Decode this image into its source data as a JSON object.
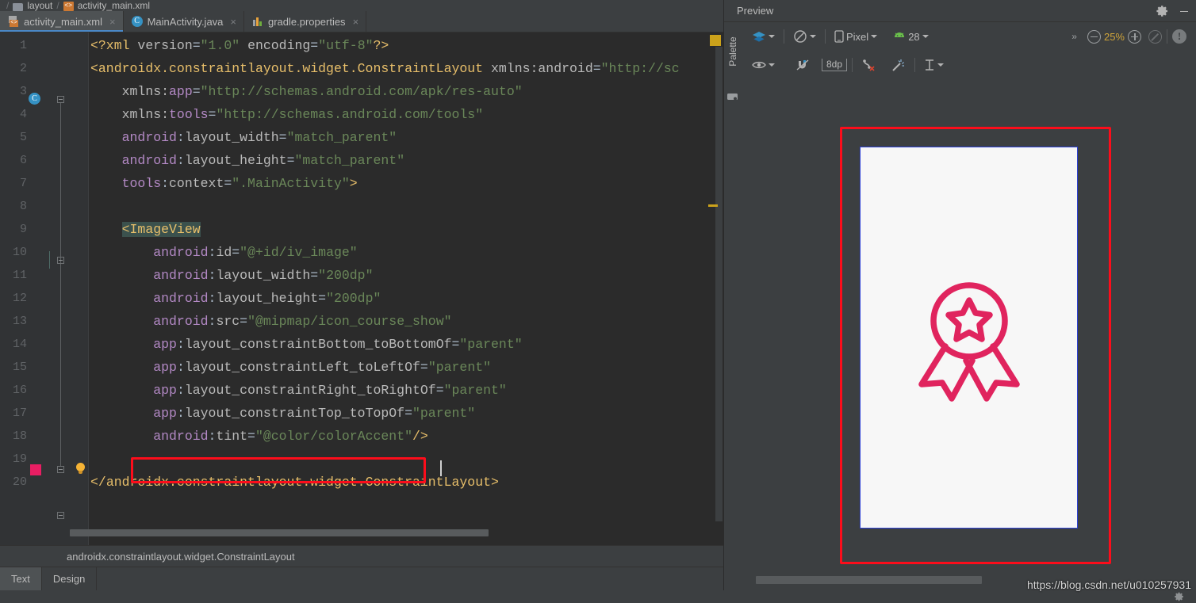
{
  "breadcrumb": {
    "folder": "layout",
    "separator": "/",
    "file": "activity_main.xml",
    "xml_badge": "<>"
  },
  "tabs": [
    {
      "label": "activity_main.xml",
      "icon": "xml-file-icon",
      "close": "×",
      "active": true
    },
    {
      "label": "MainActivity.java",
      "icon": "java-class-icon",
      "close": "×",
      "active": false
    },
    {
      "label": "gradle.properties",
      "icon": "gradle-file-icon",
      "close": "×",
      "active": false
    }
  ],
  "editor": {
    "line_numbers": [
      "1",
      "2",
      "3",
      "4",
      "5",
      "6",
      "7",
      "8",
      "9",
      "10",
      "11",
      "12",
      "13",
      "14",
      "15",
      "16",
      "17",
      "18",
      "19",
      "20"
    ],
    "lines": [
      {
        "n": "1",
        "segments": [
          {
            "t": "<?xml ",
            "c": "brack"
          },
          {
            "t": "version",
            "c": "attr"
          },
          {
            "t": "=",
            "c": "punct"
          },
          {
            "t": "\"1.0\"",
            "c": "str"
          },
          {
            "t": " ",
            "c": "punct"
          },
          {
            "t": "encoding",
            "c": "attr"
          },
          {
            "t": "=",
            "c": "punct"
          },
          {
            "t": "\"utf-8\"",
            "c": "str"
          },
          {
            "t": "?>",
            "c": "brack"
          }
        ]
      },
      {
        "n": "2",
        "segments": [
          {
            "t": "<",
            "c": "brack"
          },
          {
            "t": "androidx.constraintlayout.widget.ConstraintLayout",
            "c": "tag"
          },
          {
            "t": " ",
            "c": "punct"
          },
          {
            "t": "xmlns:android",
            "c": "attr"
          },
          {
            "t": "=",
            "c": "punct"
          },
          {
            "t": "\"http://sc",
            "c": "str"
          }
        ]
      },
      {
        "n": "3",
        "segments": [
          {
            "t": "    ",
            "c": "punct"
          },
          {
            "t": "xmlns:",
            "c": "attr"
          },
          {
            "t": "app",
            "c": "ns"
          },
          {
            "t": "=",
            "c": "punct"
          },
          {
            "t": "\"http://schemas.android.com/apk/res-auto\"",
            "c": "str"
          }
        ]
      },
      {
        "n": "4",
        "segments": [
          {
            "t": "    ",
            "c": "punct"
          },
          {
            "t": "xmlns:",
            "c": "attr"
          },
          {
            "t": "tools",
            "c": "ns"
          },
          {
            "t": "=",
            "c": "punct"
          },
          {
            "t": "\"http://schemas.android.com/tools\"",
            "c": "str"
          }
        ]
      },
      {
        "n": "5",
        "segments": [
          {
            "t": "    ",
            "c": "punct"
          },
          {
            "t": "android",
            "c": "ns"
          },
          {
            "t": ":",
            "c": "punct"
          },
          {
            "t": "layout_width",
            "c": "attr"
          },
          {
            "t": "=",
            "c": "punct"
          },
          {
            "t": "\"match_parent\"",
            "c": "str"
          }
        ]
      },
      {
        "n": "6",
        "segments": [
          {
            "t": "    ",
            "c": "punct"
          },
          {
            "t": "android",
            "c": "ns"
          },
          {
            "t": ":",
            "c": "punct"
          },
          {
            "t": "layout_height",
            "c": "attr"
          },
          {
            "t": "=",
            "c": "punct"
          },
          {
            "t": "\"match_parent\"",
            "c": "str"
          }
        ]
      },
      {
        "n": "7",
        "segments": [
          {
            "t": "    ",
            "c": "punct"
          },
          {
            "t": "tools",
            "c": "ns"
          },
          {
            "t": ":",
            "c": "punct"
          },
          {
            "t": "context",
            "c": "attr"
          },
          {
            "t": "=",
            "c": "punct"
          },
          {
            "t": "\".MainActivity\"",
            "c": "str"
          },
          {
            "t": ">",
            "c": "brack"
          }
        ]
      },
      {
        "n": "8",
        "segments": []
      },
      {
        "n": "9",
        "segments": [
          {
            "t": "    ",
            "c": "punct"
          },
          {
            "t": "<",
            "c": "brack-hl"
          },
          {
            "t": "ImageView",
            "c": "tag-hl"
          }
        ]
      },
      {
        "n": "10",
        "segments": [
          {
            "t": "        ",
            "c": "punct"
          },
          {
            "t": "android",
            "c": "ns"
          },
          {
            "t": ":",
            "c": "punct"
          },
          {
            "t": "id",
            "c": "attr"
          },
          {
            "t": "=",
            "c": "punct"
          },
          {
            "t": "\"@+id/iv_image\"",
            "c": "str"
          }
        ]
      },
      {
        "n": "11",
        "segments": [
          {
            "t": "        ",
            "c": "punct"
          },
          {
            "t": "android",
            "c": "ns"
          },
          {
            "t": ":",
            "c": "punct"
          },
          {
            "t": "layout_width",
            "c": "attr"
          },
          {
            "t": "=",
            "c": "punct"
          },
          {
            "t": "\"200dp\"",
            "c": "str"
          }
        ]
      },
      {
        "n": "12",
        "segments": [
          {
            "t": "        ",
            "c": "punct"
          },
          {
            "t": "android",
            "c": "ns"
          },
          {
            "t": ":",
            "c": "punct"
          },
          {
            "t": "layout_height",
            "c": "attr"
          },
          {
            "t": "=",
            "c": "punct"
          },
          {
            "t": "\"200dp\"",
            "c": "str"
          }
        ]
      },
      {
        "n": "13",
        "segments": [
          {
            "t": "        ",
            "c": "punct"
          },
          {
            "t": "android",
            "c": "ns"
          },
          {
            "t": ":",
            "c": "punct"
          },
          {
            "t": "src",
            "c": "attr"
          },
          {
            "t": "=",
            "c": "punct"
          },
          {
            "t": "\"@mipmap/icon_course_show\"",
            "c": "str"
          }
        ]
      },
      {
        "n": "14",
        "segments": [
          {
            "t": "        ",
            "c": "punct"
          },
          {
            "t": "app",
            "c": "ns"
          },
          {
            "t": ":",
            "c": "punct"
          },
          {
            "t": "layout_constraintBottom_toBottomOf",
            "c": "attr"
          },
          {
            "t": "=",
            "c": "punct"
          },
          {
            "t": "\"parent\"",
            "c": "str"
          }
        ]
      },
      {
        "n": "15",
        "segments": [
          {
            "t": "        ",
            "c": "punct"
          },
          {
            "t": "app",
            "c": "ns"
          },
          {
            "t": ":",
            "c": "punct"
          },
          {
            "t": "layout_constraintLeft_toLeftOf",
            "c": "attr"
          },
          {
            "t": "=",
            "c": "punct"
          },
          {
            "t": "\"parent\"",
            "c": "str"
          }
        ]
      },
      {
        "n": "16",
        "segments": [
          {
            "t": "        ",
            "c": "punct"
          },
          {
            "t": "app",
            "c": "ns"
          },
          {
            "t": ":",
            "c": "punct"
          },
          {
            "t": "layout_constraintRight_toRightOf",
            "c": "attr"
          },
          {
            "t": "=",
            "c": "punct"
          },
          {
            "t": "\"parent\"",
            "c": "str"
          }
        ]
      },
      {
        "n": "17",
        "segments": [
          {
            "t": "        ",
            "c": "punct"
          },
          {
            "t": "app",
            "c": "ns"
          },
          {
            "t": ":",
            "c": "punct"
          },
          {
            "t": "layout_constraintTop_toTopOf",
            "c": "attr"
          },
          {
            "t": "=",
            "c": "punct"
          },
          {
            "t": "\"parent\"",
            "c": "str"
          }
        ]
      },
      {
        "n": "18",
        "segments": [
          {
            "t": "        ",
            "c": "punct"
          },
          {
            "t": "android",
            "c": "ns"
          },
          {
            "t": ":",
            "c": "punct"
          },
          {
            "t": "tint",
            "c": "attr"
          },
          {
            "t": "=",
            "c": "punct"
          },
          {
            "t": "\"@color/colorAccent\"",
            "c": "str"
          },
          {
            "t": "/>",
            "c": "brack"
          }
        ]
      },
      {
        "n": "19",
        "segments": []
      },
      {
        "n": "20",
        "segments": [
          {
            "t": "",
            "c": "punct"
          },
          {
            "t": "</",
            "c": "brack"
          },
          {
            "t": "androidx.constraintlayout.widget.ConstraintLayout",
            "c": "tag"
          },
          {
            "t": ">",
            "c": "brack"
          }
        ]
      }
    ],
    "gutter": {
      "class_marker_line": "2",
      "class_marker_glyph": "C",
      "color_swatch_line": "18",
      "color_swatch_hex": "#e91e63",
      "intention_bulb_line": "18",
      "intention_bulb_name": "lightbulb-icon"
    },
    "annotation_color": "#fc0d1b"
  },
  "status": {
    "component_path": "androidx.constraintlayout.widget.ConstraintLayout"
  },
  "mode_tabs": [
    {
      "label": "Text",
      "active": true
    },
    {
      "label": "Design",
      "active": false
    }
  ],
  "preview": {
    "title": "Preview",
    "gear_icon": "gear-icon",
    "minimize_icon": "minimize-icon",
    "palette_label": "Palette",
    "palette_icon": "palette-icon",
    "toolbar_row1": [
      {
        "name": "design-mode-select",
        "icon": "layers-icon",
        "label": "",
        "dropdown": true
      },
      {
        "name": "orientation-select",
        "icon": "rotate-icon",
        "label": "",
        "dropdown": true
      },
      {
        "name": "device-select",
        "icon": "phone-icon",
        "label": "Pixel",
        "dropdown": true
      },
      {
        "name": "api-level-select",
        "icon": "android-icon",
        "label": "28",
        "dropdown": true
      }
    ],
    "overflow_label": "»",
    "zoom_out_icon": "zoom-out-icon",
    "zoom_level": "25%",
    "zoom_in_icon": "zoom-in-icon",
    "zoom_fit_icon": "zoom-to-fit-icon",
    "issues_icon": "warning-icon",
    "toolbar_row2": [
      {
        "name": "view-options-select",
        "icon": "eye-icon",
        "dropdown": true
      },
      {
        "name": "autoconnect-toggle",
        "icon": "magnet-off-icon",
        "dropdown": false
      },
      {
        "name": "default-margin",
        "icon": "margin-icon",
        "label": "8dp",
        "dropdown": false
      },
      {
        "name": "clear-constraints-button",
        "icon": "clear-constraints-icon",
        "dropdown": false
      },
      {
        "name": "infer-constraints-button",
        "icon": "magic-wand-icon",
        "dropdown": false
      },
      {
        "name": "align-select",
        "icon": "align-vertical-icon",
        "dropdown": true
      }
    ],
    "device_screen_bg": "#f7f7f7",
    "selection_border_color": "#2b3fd6",
    "widget_icon": "award-ribbon-icon",
    "widget_icon_color": "#e0245e"
  },
  "watermark": {
    "text": "https://blog.csdn.net/u010257931"
  },
  "colors": {
    "editor_bg": "#2b2b2b",
    "gutter_bg": "#313335",
    "panel_bg": "#3c3f41",
    "accent_tab": "#4a88c7",
    "annotation_red": "#fc0d1b"
  }
}
